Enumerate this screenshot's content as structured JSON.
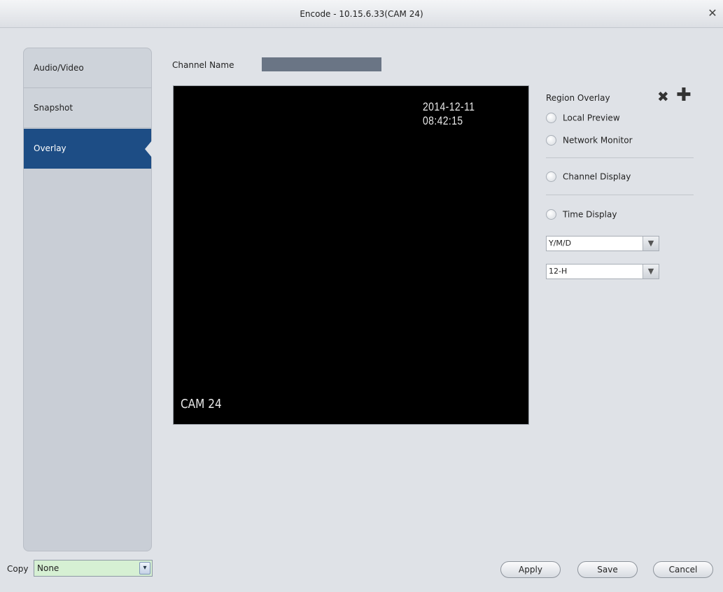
{
  "window": {
    "title": "Encode - 10.15.6.33(CAM 24)",
    "close_symbol": "✕"
  },
  "sidebar": {
    "items": [
      {
        "label": "Audio/Video",
        "selected": false
      },
      {
        "label": "Snapshot",
        "selected": false
      },
      {
        "label": "Overlay",
        "selected": true
      }
    ]
  },
  "channel": {
    "label": "Channel Name",
    "value": ""
  },
  "preview": {
    "timestamp": "2014-12-11 08:42:15",
    "camera_name": "CAM 24"
  },
  "overlay": {
    "region_overlay_label": "Region Overlay",
    "delete_icon_symbol": "✖",
    "add_icon_symbol": "✚",
    "local_preview_label": "Local Preview",
    "network_monitor_label": "Network Monitor",
    "channel_display_label": "Channel Display",
    "time_display_label": "Time Display",
    "date_format": "Y/M/D",
    "time_format": "12-H",
    "dropdown_arrow": "▼"
  },
  "copy": {
    "label": "Copy",
    "value": "None",
    "arrow": "▾"
  },
  "buttons": {
    "apply": "Apply",
    "save": "Save",
    "cancel": "Cancel"
  },
  "colors": {
    "selected_tab": "#1d4d85",
    "video_bg": "#000000",
    "copy_select_bg": "#d6f0d3"
  }
}
